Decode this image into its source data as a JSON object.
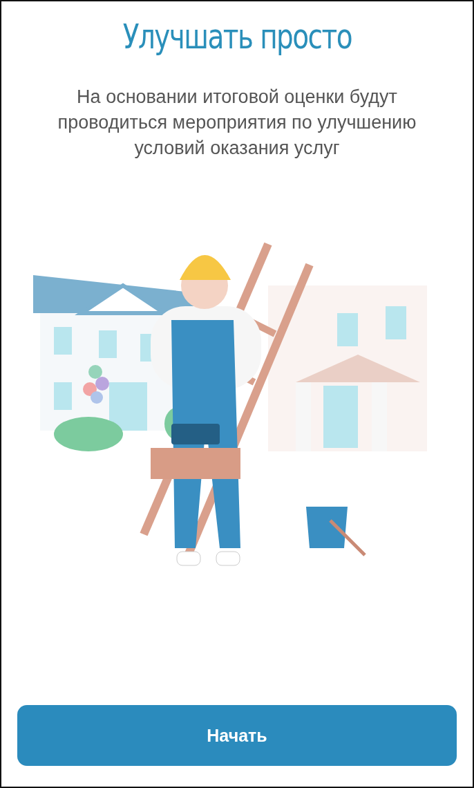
{
  "title": "Улучшать просто",
  "description": "На основании итоговой оценки будут проводиться мероприятия по улучшению условий оказания услуг",
  "start_button": {
    "label": "Начать"
  }
}
